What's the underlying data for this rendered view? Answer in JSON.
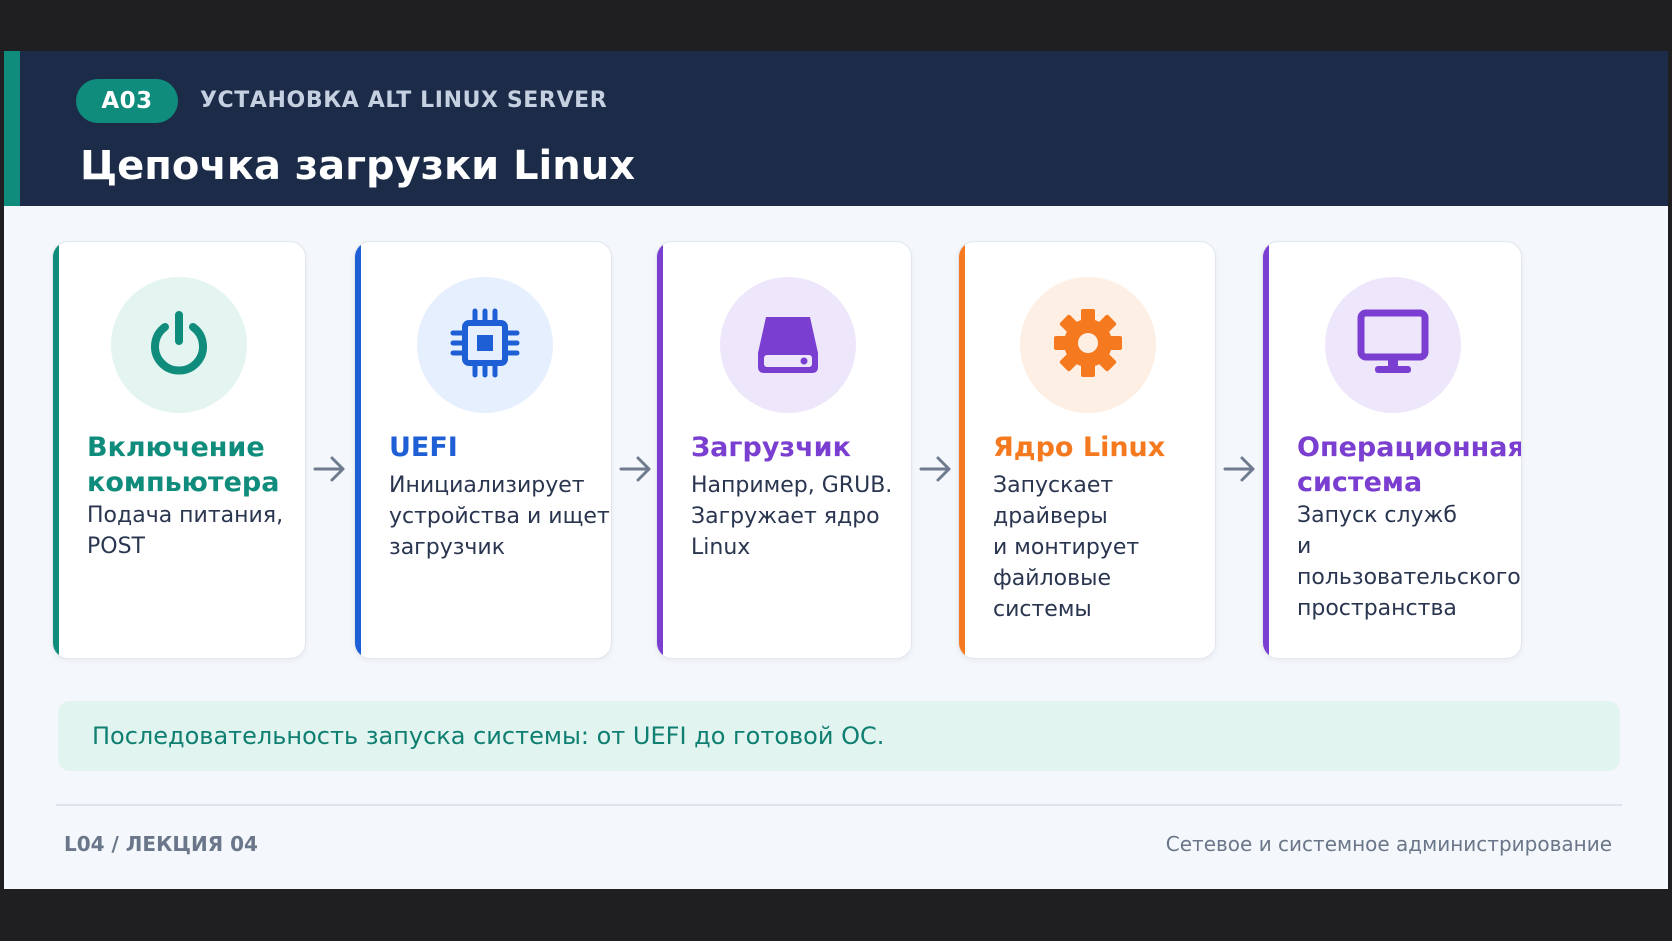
{
  "header": {
    "badge": "A03",
    "course": "УСТАНОВКА ALT LINUX SERVER",
    "title": "Цепочка загрузки Linux"
  },
  "steps": [
    {
      "icon": "power-icon",
      "title_line1": "Включение",
      "title_line2": "компьютера",
      "description": "Подача питания,\nPOST",
      "accent": "#0f8c7c",
      "icon_bg": "#e4f4f0"
    },
    {
      "icon": "chip-icon",
      "title_line1": "UEFI",
      "title_line2": "",
      "description": "Инициализирует\nустройства и ищет\nзагрузчик",
      "accent": "#1f5fd6",
      "icon_bg": "#e6effd"
    },
    {
      "icon": "hard-drive-icon",
      "title_line1": "Загрузчик",
      "title_line2": "",
      "description": "Например, GRUB.\nЗагружает ядро\nLinux",
      "accent": "#7a3fd0",
      "icon_bg": "#eee6fb"
    },
    {
      "icon": "gear-icon",
      "title_line1": "Ядро Linux",
      "title_line2": "",
      "description": "Запускает драйверы\nи монтирует\nфайловые системы",
      "accent": "#f5791f",
      "icon_bg": "#fdefe3"
    },
    {
      "icon": "monitor-icon",
      "title_line1": "Операционная",
      "title_line2": "система",
      "description": "Запуск служб\nи пользовательского\nпространства",
      "accent": "#7a3fd0",
      "icon_bg": "#eee6fb"
    }
  ],
  "note": "Последовательность запуска системы: от UEFI до готовой ОС.",
  "footer": {
    "left": "L04 / ЛЕКЦИЯ 04",
    "right": "Сетевое и системное администрирование"
  },
  "colors": {
    "header_bg": "#1b2b48",
    "accent": "#0f8c7c",
    "arrow": "#6f7b8e"
  }
}
